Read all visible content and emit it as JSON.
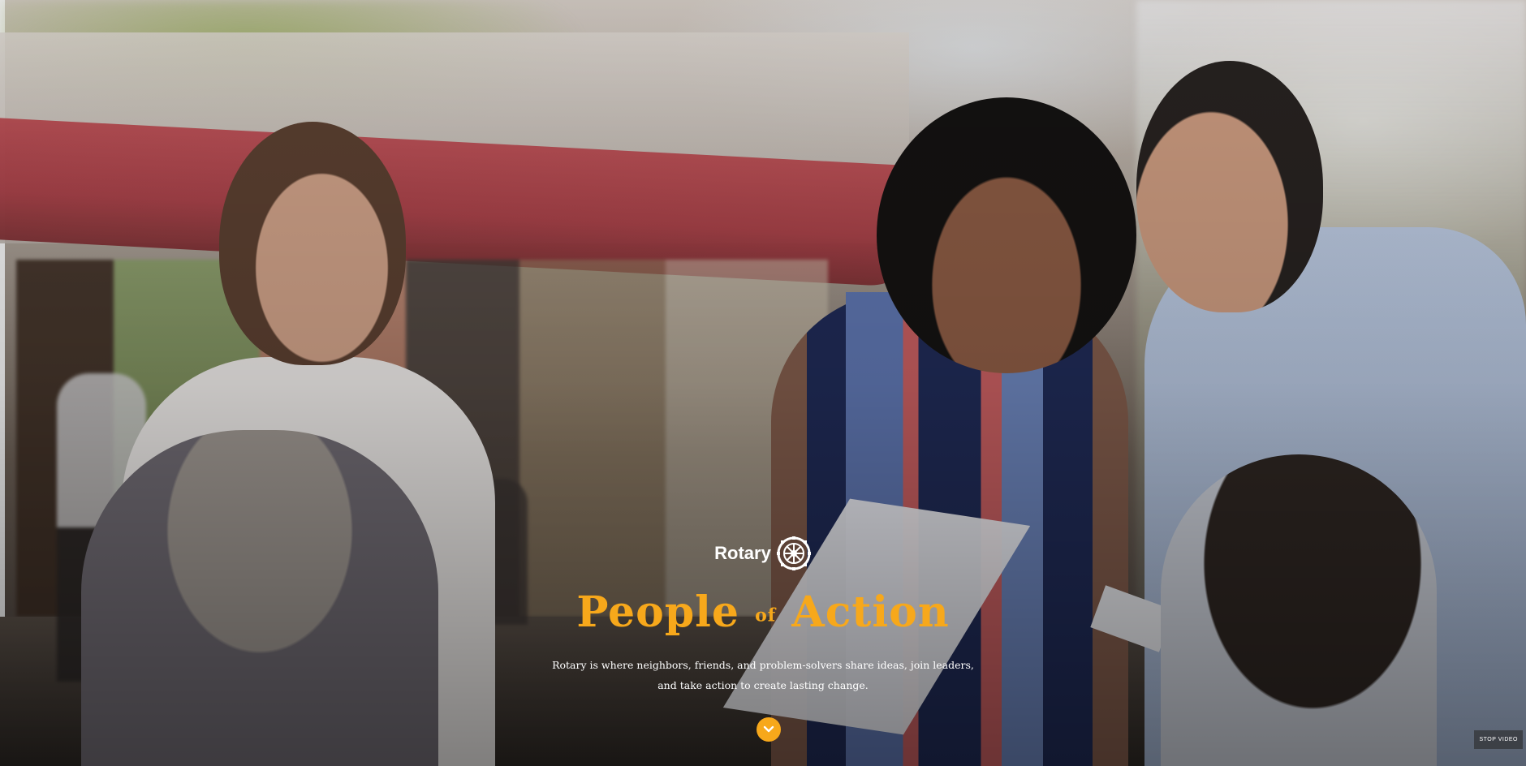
{
  "hero": {
    "logo_text": "Rotary",
    "logo_icon": "rotary-wheel-icon",
    "headline_part1": "People",
    "headline_of": "of",
    "headline_part2": "Action",
    "subtitle_line1": "Rotary is where neighbors, friends, and problem-solvers share ideas, join leaders,",
    "subtitle_line2": "and take action to create lasting change.",
    "scroll_icon": "chevron-down-icon",
    "stop_video_label": "STOP VIDEO"
  },
  "colors": {
    "accent_gold": "#f7a81b",
    "text_white": "#ffffff"
  }
}
